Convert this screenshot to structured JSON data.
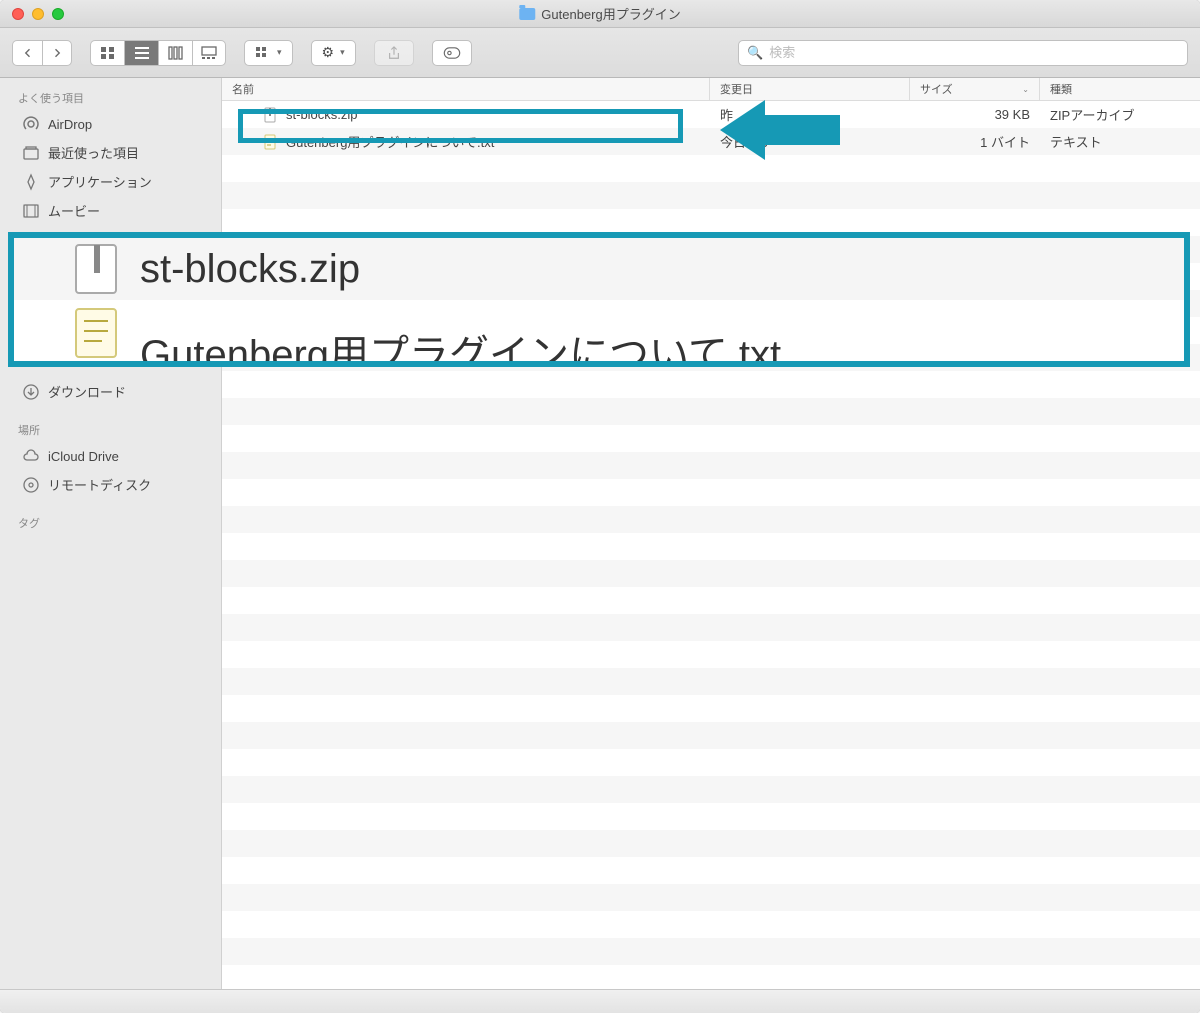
{
  "window": {
    "title": "Gutenberg用プラグイン"
  },
  "toolbar": {
    "search_placeholder": "検索"
  },
  "sidebar": {
    "sections": {
      "favorites": {
        "title": "よく使う項目",
        "items": [
          {
            "icon": "airdrop",
            "label": "AirDrop"
          },
          {
            "icon": "recents",
            "label": "最近使った項目"
          },
          {
            "icon": "applications",
            "label": "アプリケーション"
          },
          {
            "icon": "movies",
            "label": "ムービー"
          }
        ]
      },
      "locations": {
        "title": "場所",
        "items": [
          {
            "icon": "icloud",
            "label": "iCloud Drive"
          },
          {
            "icon": "remote-disc",
            "label": "リモートディスク"
          }
        ]
      },
      "tags": {
        "title": "タグ"
      }
    },
    "downloads_label": "ダウンロード"
  },
  "columns": {
    "name": "名前",
    "date": "変更日",
    "size": "サイズ",
    "kind": "種類"
  },
  "files": [
    {
      "name": "st-blocks.zip",
      "date": "昨",
      "size": "39 KB",
      "kind": "ZIPアーカイブ",
      "icon": "zip"
    },
    {
      "name": "Gutenberg用プラグインについて.txt",
      "date": "今日 1   6",
      "size": "1 バイト",
      "kind": "テキスト",
      "icon": "txt"
    }
  ],
  "zoom": {
    "file1": "st-blocks.zip",
    "file2_partial": "Gutenberg用プラグインについて txt"
  },
  "accent_color": "#1699b5"
}
